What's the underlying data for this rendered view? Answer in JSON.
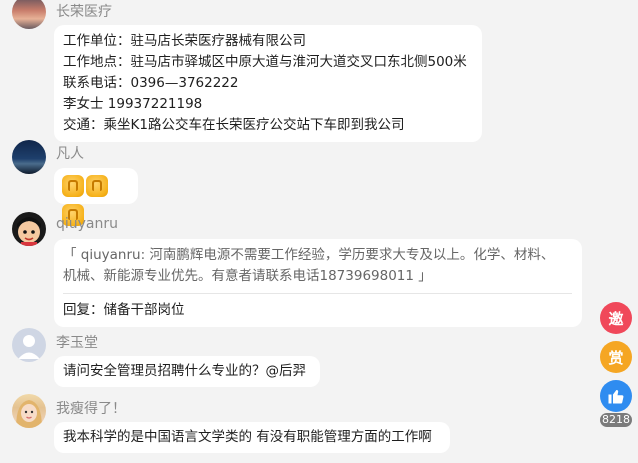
{
  "comments": [
    {
      "username": "长荣医疗",
      "lines": [
        "工作单位：驻马店长荣医疗器械有限公司",
        "工作地点：驻马店市驿城区中原大道与淮河大道交叉口东北侧500米",
        "联系电话：0396—3762222",
        "李女士 19937221198",
        "交通：乘坐K1路公交车在长荣医疗公交站下车即到我公司"
      ]
    },
    {
      "username": "凡人",
      "emoji_count": 3
    },
    {
      "username": "qiuyanru",
      "quote_lines": [
        "「 qiuyanru: 河南鹏辉电源不需要工作经验，学历要求大专及以上。化学、材料、",
        "机械、新能源专业优先。有意者请联系电话18739698011 」"
      ],
      "reply": "回复：储备干部岗位"
    },
    {
      "username": "李玉堂",
      "text": "请问安全管理员招聘什么专业的？@后羿"
    },
    {
      "username": "我瘦得了！",
      "text": "我本科学的是中国语言文学类的 有没有职能管理方面的工作啊"
    }
  ],
  "side_actions": {
    "invite_label": "邀",
    "reward_label": "赏",
    "like_count": "8218"
  },
  "colors": {
    "invite": "#f0485a",
    "reward": "#f5a623",
    "like": "#2f8cf0"
  }
}
